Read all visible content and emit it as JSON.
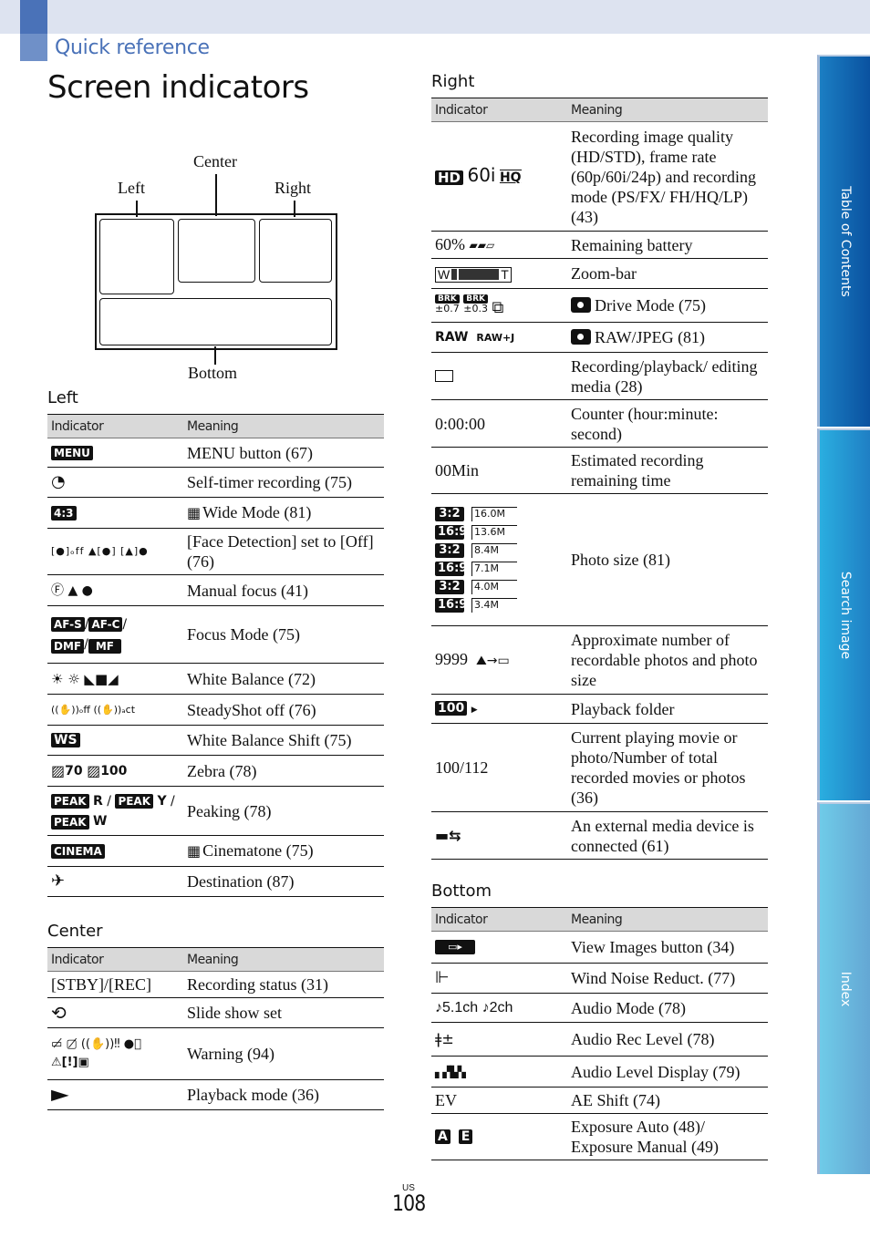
{
  "header": {
    "section": "Quick reference",
    "title": "Screen indicators"
  },
  "diagram": {
    "labels": {
      "left": "Left",
      "center": "Center",
      "right": "Right",
      "bottom": "Bottom"
    }
  },
  "columns": {
    "indicator": "Indicator",
    "meaning": "Meaning"
  },
  "left": {
    "title": "Left",
    "rows": [
      {
        "icon": "menu-icon",
        "indicator": "MENU",
        "meaning": "MENU button (67)"
      },
      {
        "icon": "self-timer-icon",
        "indicator": "◔",
        "meaning": "Self-timer recording (75)"
      },
      {
        "icon": "wide-mode-icon",
        "indicator": "4:3",
        "meaning_prefix_icon": "film-icon",
        "meaning": "Wide Mode (81)"
      },
      {
        "icon": "face-detection-icon",
        "indicator": "[•]off  ▲[•]  [▲]•",
        "meaning": "[Face Detection] set to [Off] (76)"
      },
      {
        "icon": "manual-focus-icon",
        "indicator": "Ⓕ ▲ ●",
        "meaning": "Manual focus (41)"
      },
      {
        "icon": "focus-mode-icon",
        "indicator": [
          "AF-S",
          "AF-C",
          "DMF",
          "MF"
        ],
        "meaning": "Focus Mode (75)"
      },
      {
        "icon": "white-balance-icon",
        "indicator": "☀ ☼ ◣■◢",
        "meaning": "White Balance (72)"
      },
      {
        "icon": "steadyshot-off-icon",
        "indicator": "((✋))off ((✋))act",
        "meaning": "SteadyShot off (76)"
      },
      {
        "icon": "white-balance-shift-icon",
        "indicator": "WS",
        "meaning": "White Balance Shift (75)"
      },
      {
        "icon": "zebra-icon",
        "indicator": [
          "70",
          "100"
        ],
        "meaning": "Zebra (78)"
      },
      {
        "icon": "peaking-icon",
        "indicator": [
          "PEAK R",
          "PEAK Y",
          "PEAK W"
        ],
        "meaning": "Peaking (78)"
      },
      {
        "icon": "cinema-icon",
        "indicator": "CINEMA",
        "meaning_prefix_icon": "film-icon",
        "meaning": "Cinematone (75)"
      },
      {
        "icon": "destination-icon",
        "indicator": "✈",
        "meaning": "Destination (87)"
      }
    ]
  },
  "center": {
    "title": "Center",
    "rows": [
      {
        "indicator": "[STBY]/[REC]",
        "meaning": "Recording status (31)"
      },
      {
        "icon": "slide-show-icon",
        "indicator": "⟲",
        "meaning": "Slide show set"
      },
      {
        "icon": "warning-icon",
        "indicator": "▭̸ ▢̸ ((✋))!! ●⃠ ⚠[!]▲",
        "meaning": "Warning (94)"
      },
      {
        "icon": "playback-mode-icon",
        "indicator": "▶",
        "meaning": "Playback mode (36)"
      }
    ]
  },
  "right": {
    "title": "Right",
    "rows": [
      {
        "icon": "image-quality-icon",
        "indicator": [
          "HD",
          "60i",
          "HQ"
        ],
        "meaning": "Recording image quality (HD/STD), frame rate (60p/60i/24p) and recording mode (PS/FX/ FH/HQ/LP) (43)"
      },
      {
        "icon": "battery-icon",
        "indicator": "60%",
        "meaning": "Remaining battery"
      },
      {
        "icon": "zoom-bar-icon",
        "indicator": [
          "W",
          "T"
        ],
        "zoom_level": 0.2,
        "meaning": "Zoom-bar"
      },
      {
        "icon": "drive-mode-icon",
        "indicator": [
          "BRK ±0.7",
          "BRK ±0.3",
          "⧉"
        ],
        "meaning_prefix_icon": "camera-icon",
        "meaning": "Drive Mode (75)"
      },
      {
        "icon": "raw-jpeg-icon",
        "indicator": [
          "RAW",
          "RAW+J"
        ],
        "meaning_prefix_icon": "camera-icon",
        "meaning": "RAW/JPEG (81)"
      },
      {
        "icon": "media-card-icon",
        "indicator": "▭",
        "meaning": "Recording/playback/ editing media (28)"
      },
      {
        "indicator": "0:00:00",
        "meaning": "Counter (hour:minute: second)"
      },
      {
        "indicator": "00Min",
        "meaning": "Estimated recording remaining time"
      },
      {
        "icon": "photo-size-icon",
        "indicator": [
          {
            "ratio": "3:2",
            "size": "16.0M"
          },
          {
            "ratio": "16:9",
            "size": "13.6M"
          },
          {
            "ratio": "3:2",
            "size": "8.4M"
          },
          {
            "ratio": "16:9",
            "size": "7.1M"
          },
          {
            "ratio": "3:2",
            "size": "4.0M"
          },
          {
            "ratio": "16:9",
            "size": "3.4M"
          }
        ],
        "meaning": "Photo size (81)"
      },
      {
        "icon": "recordable-photos-icon",
        "indicator": "9999",
        "meaning": "Approximate number of recordable photos and photo size"
      },
      {
        "icon": "playback-folder-icon",
        "indicator": "100",
        "meaning": "Playback folder"
      },
      {
        "indicator": "100/112",
        "meaning": "Current playing movie or photo/Number of total recorded movies or photos (36)"
      },
      {
        "icon": "usb-media-icon",
        "indicator": "⇆",
        "meaning": "An external media device is connected (61)"
      }
    ]
  },
  "bottom": {
    "title": "Bottom",
    "rows": [
      {
        "icon": "view-images-button-icon",
        "indicator": "▶",
        "meaning": "View Images button (34)"
      },
      {
        "icon": "wind-noise-icon",
        "indicator": "⚐",
        "meaning": "Wind Noise Reduct. (77)"
      },
      {
        "icon": "audio-mode-icon",
        "indicator": "♪5.1ch ♪2ch",
        "meaning": "Audio Mode (78)"
      },
      {
        "icon": "audio-rec-level-icon",
        "indicator": "🎤±",
        "meaning": "Audio Rec Level (78)"
      },
      {
        "icon": "audio-level-display-icon",
        "indicator": "▮▮▮",
        "meaning": "Audio Level Display (79)"
      },
      {
        "indicator": "EV",
        "meaning": "AE Shift (74)"
      },
      {
        "icon": "exposure-icon",
        "indicator": [
          "A",
          "E"
        ],
        "meaning": "Exposure Auto (48)/ Exposure Manual (49)"
      }
    ]
  },
  "side_tabs": {
    "toc": "Table of Contents",
    "search": "Search image",
    "index": "Index"
  },
  "footer": {
    "region": "US",
    "page": "108"
  }
}
